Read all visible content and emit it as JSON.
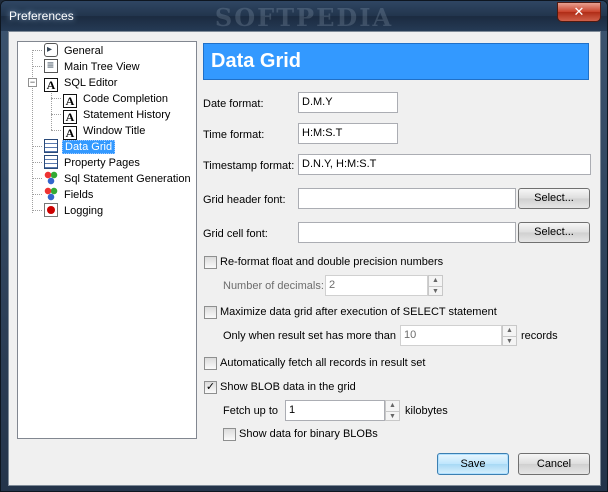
{
  "window": {
    "title": "Preferences",
    "watermark": "SOFTPEDIA",
    "close_glyph": "✕"
  },
  "tree": {
    "items": [
      {
        "label": "General",
        "icon": "general-icon"
      },
      {
        "label": "Main Tree View",
        "icon": "tree-view-icon"
      },
      {
        "label": "SQL Editor",
        "icon": "sql-editor-icon",
        "expander": "−"
      },
      {
        "label": "Code Completion",
        "icon": "font-icon"
      },
      {
        "label": "Statement History",
        "icon": "font-icon"
      },
      {
        "label": "Window Title",
        "icon": "font-icon"
      },
      {
        "label": "Data Grid",
        "icon": "grid-icon",
        "selected": true
      },
      {
        "label": "Property Pages",
        "icon": "grid-icon"
      },
      {
        "label": "Sql Statement Generation",
        "icon": "generation-icon"
      },
      {
        "label": "Fields",
        "icon": "fields-icon"
      },
      {
        "label": "Logging",
        "icon": "logging-icon"
      }
    ]
  },
  "page": {
    "header": "Data Grid",
    "date_format_label": "Date format:",
    "date_format_value": "D.M.Y",
    "time_format_label": "Time format:",
    "time_format_value": "H:M:S.T",
    "timestamp_format_label": "Timestamp format:",
    "timestamp_format_value": "D.N.Y, H:M:S.T",
    "grid_header_font_label": "Grid header font:",
    "grid_header_font_value": "",
    "grid_cell_font_label": "Grid cell font:",
    "grid_cell_font_value": "",
    "select_label": "Select...",
    "reformat_label": "Re-format float and double precision numbers",
    "reformat_checked": false,
    "decimals_label": "Number of decimals:",
    "decimals_value": "2",
    "maximize_label": "Maximize data grid after execution of SELECT statement",
    "maximize_checked": false,
    "only_when_label": "Only when result set has more than",
    "only_when_value": "10",
    "records_label": "records",
    "autofetch_label": "Automatically fetch all records in result set",
    "autofetch_checked": false,
    "show_blob_label": "Show BLOB data in the grid",
    "show_blob_checked": true,
    "fetch_up_to_label": "Fetch up to",
    "fetch_up_to_value": "1",
    "kilobytes_label": "kilobytes",
    "binary_blob_label": "Show data for binary BLOBs",
    "binary_blob_checked": false,
    "check_glyph": "✓",
    "spin_up": "▲",
    "spin_down": "▼"
  },
  "buttons": {
    "save": "Save",
    "cancel": "Cancel"
  }
}
